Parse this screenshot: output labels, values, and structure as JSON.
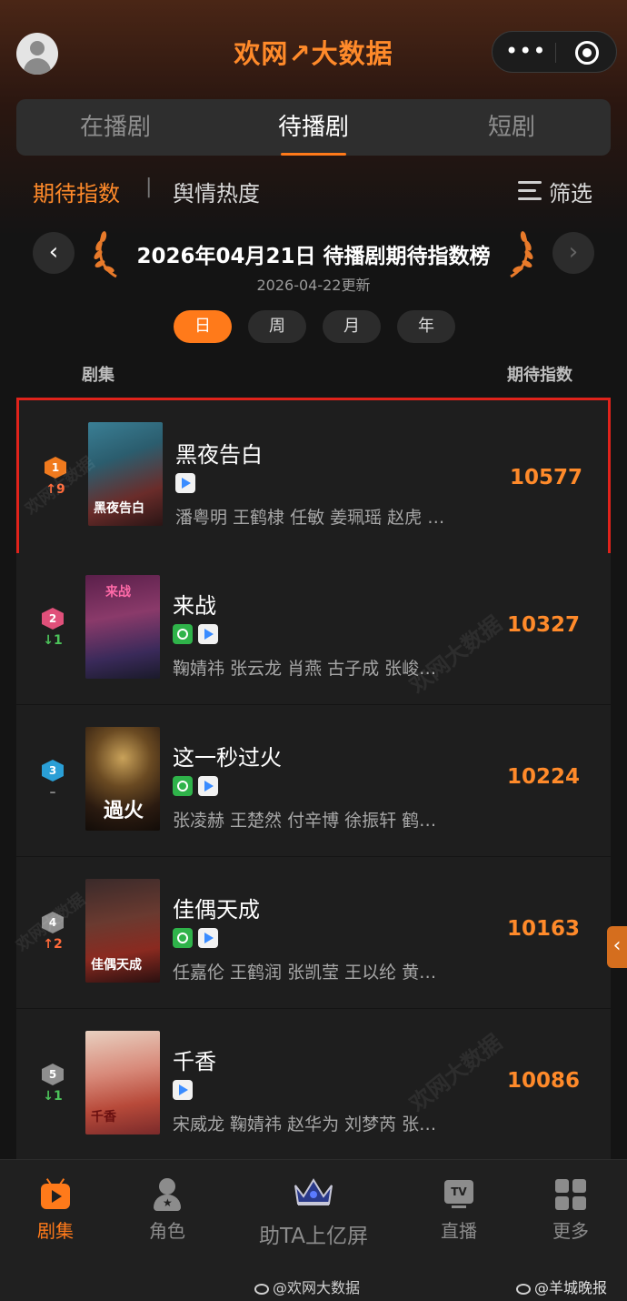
{
  "header": {
    "logo_text": "欢网↗大数据",
    "more_glyph": "•••"
  },
  "tabs": [
    {
      "label": "在播剧",
      "active": false
    },
    {
      "label": "待播剧",
      "active": true
    },
    {
      "label": "短剧",
      "active": false
    }
  ],
  "subfilter": {
    "primary": "期待指数",
    "separator": "|",
    "secondary": "舆情热度",
    "filter_label": "筛选"
  },
  "ranking": {
    "title": "2026年04月21日 待播剧期待指数榜",
    "updated": "2026-04-22更新",
    "prev_glyph": "‹",
    "next_glyph": "›"
  },
  "periods": [
    {
      "label": "日",
      "active": true
    },
    {
      "label": "周",
      "active": false
    },
    {
      "label": "月",
      "active": false
    },
    {
      "label": "年",
      "active": false
    }
  ],
  "columns": {
    "left": "剧集",
    "right": "期待指数"
  },
  "rows": [
    {
      "rank": "1",
      "trend": "↑9",
      "trend_dir": "up",
      "rank_color": "#f07a1e",
      "title": "黑夜告白",
      "poster_caption": "黑夜告白",
      "cast": "潘粤明 王鹤棣 任敏 姜珮瑶 赵虎 …",
      "score": "10577",
      "platforms": [
        "play"
      ]
    },
    {
      "rank": "2",
      "trend": "↓1",
      "trend_dir": "down",
      "rank_color": "#e0507a",
      "title": "来战",
      "poster_caption": "来战",
      "cast": "鞠婧祎 张云龙 肖燕 古子成 张峻…",
      "score": "10327",
      "platforms": [
        "green",
        "play"
      ]
    },
    {
      "rank": "3",
      "trend": "–",
      "trend_dir": "flat",
      "rank_color": "#2a9fd6",
      "title": "这一秒过火",
      "poster_caption": "過火",
      "cast": "张凌赫 王楚然 付辛博 徐振轩 鹤…",
      "score": "10224",
      "platforms": [
        "green",
        "play"
      ]
    },
    {
      "rank": "4",
      "trend": "↑2",
      "trend_dir": "up",
      "rank_color": "#8f8f8f",
      "title": "佳偶天成",
      "poster_caption": "佳偶天成",
      "cast": "任嘉伦 王鹤润 张凯莹 王以纶 黄…",
      "score": "10163",
      "platforms": [
        "green",
        "play"
      ]
    },
    {
      "rank": "5",
      "trend": "↓1",
      "trend_dir": "down",
      "rank_color": "#8f8f8f",
      "title": "千香",
      "poster_caption": "千香",
      "cast": "宋威龙 鞠婧祎 赵华为 刘梦芮 张…",
      "score": "10086",
      "platforms": [
        "play"
      ]
    }
  ],
  "watermark_text": "欢网大数据",
  "side_handle_glyph": "‹",
  "bottom_nav": [
    {
      "label": "剧集",
      "icon": "tv-icon",
      "active": true
    },
    {
      "label": "角色",
      "icon": "role-icon",
      "active": false
    },
    {
      "label": "助TA上亿屏",
      "icon": "crown-icon",
      "active": false
    },
    {
      "label": "直播",
      "icon": "live-tv-icon",
      "active": false
    },
    {
      "label": "更多",
      "icon": "grid-icon",
      "active": false
    }
  ],
  "tv_badge": "TV",
  "footer_watermarks": [
    "@欢网大数据",
    "@羊城晚报"
  ]
}
